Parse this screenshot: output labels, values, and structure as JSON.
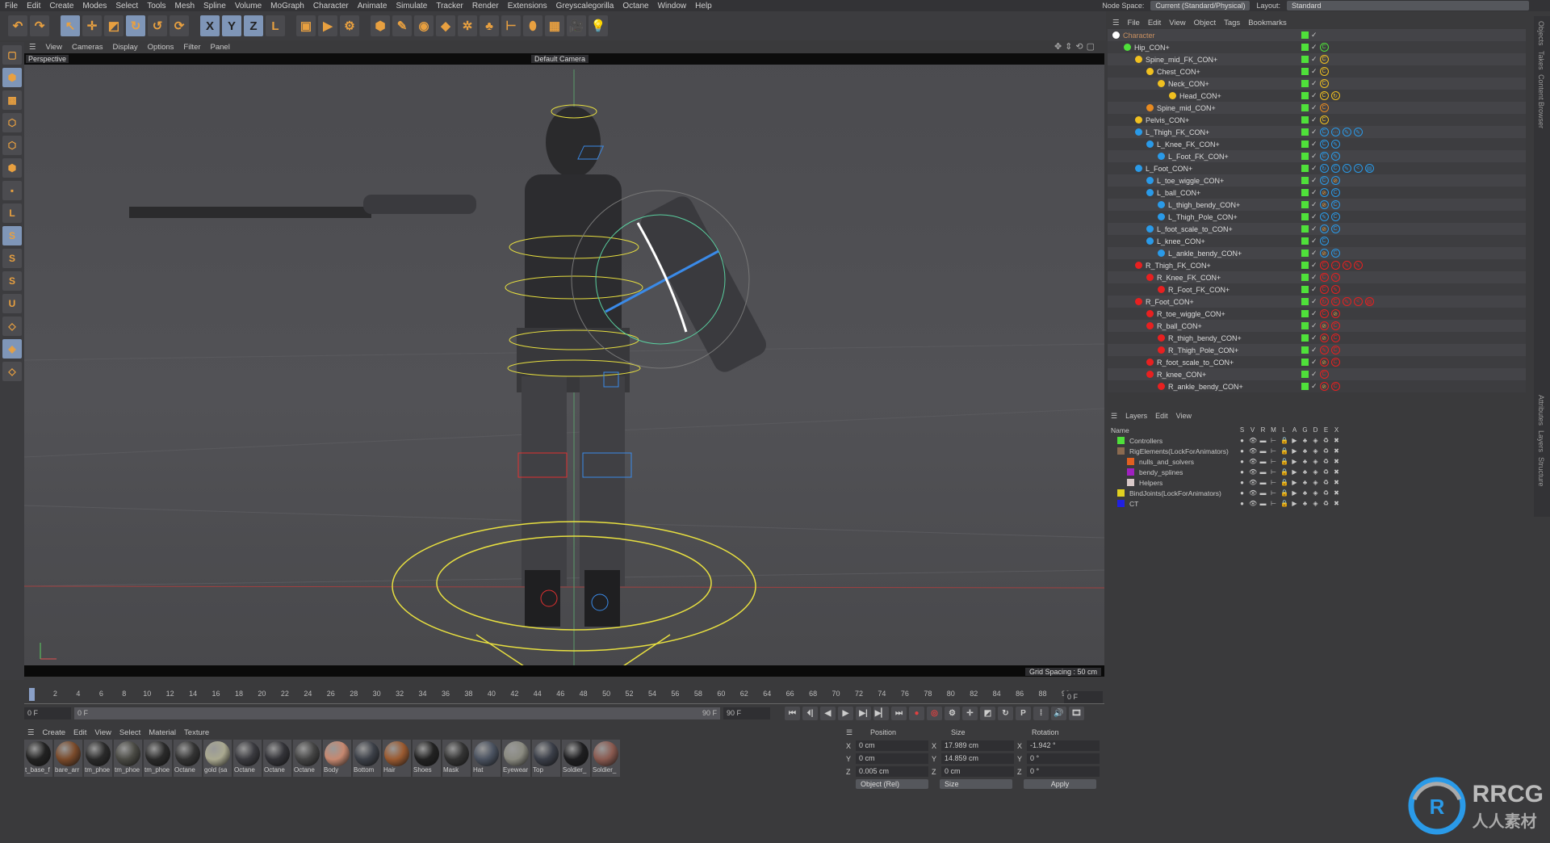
{
  "menu": [
    "File",
    "Edit",
    "Create",
    "Modes",
    "Select",
    "Tools",
    "Mesh",
    "Spline",
    "Volume",
    "MoGraph",
    "Character",
    "Animate",
    "Simulate",
    "Tracker",
    "Render",
    "Extensions",
    "Greyscalegorilla",
    "Octane",
    "Window",
    "Help"
  ],
  "header": {
    "node_space_label": "Node Space:",
    "node_space_value": "Current (Standard/Physical)",
    "layout_label": "Layout:",
    "layout_value": "Standard"
  },
  "toolbar": [
    {
      "icon": "undo-icon",
      "g": "↶"
    },
    {
      "icon": "redo-icon",
      "g": "↷"
    },
    {
      "icon": "select-icon",
      "g": "↖",
      "hl": true
    },
    {
      "icon": "move-icon",
      "g": "✛"
    },
    {
      "icon": "scale-icon",
      "g": "◩"
    },
    {
      "icon": "rotate-icon",
      "g": "↻",
      "hl": true
    },
    {
      "icon": "psr-icon",
      "g": "↺"
    },
    {
      "icon": "recent-tool-icon",
      "g": "⟳"
    },
    {
      "icon": "x-axis-icon",
      "g": "X",
      "hl": true
    },
    {
      "icon": "y-axis-icon",
      "g": "Y",
      "hl": true
    },
    {
      "icon": "z-axis-icon",
      "g": "Z",
      "hl": true
    },
    {
      "icon": "coordinate-system-icon",
      "g": "L"
    },
    {
      "icon": "render-region-icon",
      "g": "▣"
    },
    {
      "icon": "render-view-icon",
      "g": "▶"
    },
    {
      "icon": "render-settings-icon",
      "g": "⚙"
    },
    {
      "icon": "cube-icon",
      "g": "⬢"
    },
    {
      "icon": "pen-icon",
      "g": "✎"
    },
    {
      "icon": "subdivision-icon",
      "g": "◉"
    },
    {
      "icon": "extrude-icon",
      "g": "◆"
    },
    {
      "icon": "cloner-icon",
      "g": "✲"
    },
    {
      "icon": "mograph-icon",
      "g": "♣"
    },
    {
      "icon": "deformer-icon",
      "g": "⊢"
    },
    {
      "icon": "field-icon",
      "g": "⬮"
    },
    {
      "icon": "floor-icon",
      "g": "▦"
    },
    {
      "icon": "camera-icon",
      "g": "🎥"
    },
    {
      "icon": "light-icon",
      "g": "💡"
    }
  ],
  "left_tools": [
    {
      "icon": "make-editable-icon",
      "g": "▢"
    },
    {
      "icon": "model-mode-icon",
      "g": "⬢",
      "hl": true
    },
    {
      "icon": "texture-mode-icon",
      "g": "▩"
    },
    {
      "icon": "points-mode-icon",
      "g": "⬡"
    },
    {
      "icon": "edges-mode-icon",
      "g": "⬡"
    },
    {
      "icon": "polygons-mode-icon",
      "g": "⬢"
    },
    {
      "icon": "uv-mode-icon",
      "g": "▪"
    },
    {
      "icon": "axis-mode-icon",
      "g": "L"
    },
    {
      "icon": "snap-icon",
      "g": "S",
      "hl": true
    },
    {
      "icon": "snap-settings-icon",
      "g": "S"
    },
    {
      "icon": "snap-alt-icon",
      "g": "S"
    },
    {
      "icon": "magnet-icon",
      "g": "U"
    },
    {
      "icon": "workplane-icon",
      "g": "◇"
    },
    {
      "icon": "lock-workplane-icon",
      "g": "◈",
      "hl": true
    },
    {
      "icon": "workplane-rotate-icon",
      "g": "◇"
    }
  ],
  "viewport": {
    "menu": [
      "View",
      "Cameras",
      "Display",
      "Options",
      "Filter",
      "Panel"
    ],
    "name": "Perspective",
    "camera": "Default Camera",
    "grid_spacing": "Grid Spacing : 50 cm"
  },
  "timeline": {
    "start": 0,
    "end": 90,
    "step": 2,
    "current": "0 F",
    "range_start": "0 F",
    "range_label_start": "0 F",
    "range_label_end": "90 F",
    "range_end": "90 F",
    "current_field": "0 F"
  },
  "playback": [
    {
      "icon": "go-start-icon",
      "g": "⏮"
    },
    {
      "icon": "prev-key-icon",
      "g": "⏴|"
    },
    {
      "icon": "prev-frame-icon",
      "g": "◀"
    },
    {
      "icon": "play-icon",
      "g": "▶"
    },
    {
      "icon": "next-frame-icon",
      "g": "▶|"
    },
    {
      "icon": "next-key-icon",
      "g": "▶▏"
    },
    {
      "icon": "go-end-icon",
      "g": "⏭"
    },
    {
      "icon": "record-icon",
      "g": "●"
    },
    {
      "icon": "auto-key-icon",
      "g": "◎"
    },
    {
      "icon": "key-settings-icon",
      "g": "⚙"
    },
    {
      "icon": "key-position-icon",
      "g": "✛"
    },
    {
      "icon": "key-scale-icon",
      "g": "◩"
    },
    {
      "icon": "key-rotation-icon",
      "g": "↻"
    },
    {
      "icon": "key-param-icon",
      "g": "P"
    },
    {
      "icon": "key-pla-icon",
      "g": "⁞"
    },
    {
      "icon": "sound-icon",
      "g": "🔊"
    },
    {
      "icon": "film-icon",
      "g": "🎞"
    }
  ],
  "materials": {
    "menu": [
      "Create",
      "Edit",
      "View",
      "Select",
      "Material",
      "Texture"
    ],
    "items": [
      {
        "n": "t_base_f",
        "c": "#222"
      },
      {
        "n": "bare_arr",
        "c": "#7a4a2a"
      },
      {
        "n": "tm_phoe",
        "c": "#2a2a2a"
      },
      {
        "n": "tm_phoe",
        "c": "#4a4a44"
      },
      {
        "n": "tm_phoe",
        "c": "#2a2a2a"
      },
      {
        "n": "Octane",
        "c": "#333"
      },
      {
        "n": "gold (sa",
        "c": "#aaa990"
      },
      {
        "n": "Octane",
        "c": "#3a3a3f"
      },
      {
        "n": "Octane",
        "c": "#333338"
      },
      {
        "n": "Octane",
        "c": "#444"
      },
      {
        "n": "Body",
        "c": "#c68870"
      },
      {
        "n": "Bottom",
        "c": "#3c4048"
      },
      {
        "n": "Hair",
        "c": "#9a5a30"
      },
      {
        "n": "Shoes",
        "c": "#222"
      },
      {
        "n": "Mask",
        "c": "#333"
      },
      {
        "n": "Hat",
        "c": "#4a5260"
      },
      {
        "n": "Eyewear",
        "c": "#8a8a80"
      },
      {
        "n": "Top",
        "c": "#3a3e48"
      },
      {
        "n": "Soldier_",
        "c": "#1e1e20"
      },
      {
        "n": "Soldier_",
        "c": "#8a5a50"
      }
    ]
  },
  "coordinates": {
    "headers": [
      "Position",
      "Size",
      "Rotation"
    ],
    "rows": [
      {
        "axis": "X",
        "pos": "0 cm",
        "size": "17.989 cm",
        "rot": "-1.942 °"
      },
      {
        "axis": "Y",
        "pos": "0 cm",
        "size": "14.859 cm",
        "rot": "0 °"
      },
      {
        "axis": "Z",
        "pos": "0.005 cm",
        "size": "0 cm",
        "rot": "0 °"
      }
    ],
    "mode": "Object (Rel)",
    "size_mode": "Size",
    "apply": "Apply"
  },
  "objects": {
    "menu": [
      "File",
      "Edit",
      "View",
      "Object",
      "Tags",
      "Bookmarks"
    ],
    "items": [
      {
        "name": "Character",
        "d": 0,
        "c": "#ffffff",
        "tags": []
      },
      {
        "name": "Hip_CON+",
        "d": 1,
        "c": "#4fe03a",
        "tags": [
          "C"
        ]
      },
      {
        "name": "Spine_mid_FK_CON+",
        "d": 2,
        "c": "#f0c020",
        "tags": [
          "C"
        ]
      },
      {
        "name": "Chest_CON+",
        "d": 3,
        "c": "#f0c020",
        "tags": [
          "C"
        ]
      },
      {
        "name": "Neck_CON+",
        "d": 4,
        "c": "#f0c020",
        "tags": [
          "C"
        ]
      },
      {
        "name": "Head_CON+",
        "d": 5,
        "c": "#f0c020",
        "tags": [
          "C",
          "↻"
        ]
      },
      {
        "name": "Spine_mid_CON+",
        "d": 3,
        "c": "#e88a20",
        "tags": [
          "C"
        ]
      },
      {
        "name": "Pelvis_CON+",
        "d": 2,
        "c": "#f0c020",
        "tags": [
          "C"
        ]
      },
      {
        "name": "L_Thigh_FK_CON+",
        "d": 2,
        "c": "#2a9ae8",
        "tags": [
          "C",
          "⋯",
          "✎",
          "✎"
        ]
      },
      {
        "name": "L_Knee_FK_CON+",
        "d": 3,
        "c": "#2a9ae8",
        "tags": [
          "C",
          "✎"
        ]
      },
      {
        "name": "L_Foot_FK_CON+",
        "d": 4,
        "c": "#2a9ae8",
        "tags": [
          "C",
          "✎"
        ]
      },
      {
        "name": "L_Foot_CON+",
        "d": 2,
        "c": "#2a9ae8",
        "tags": [
          "↻",
          "C",
          "✎",
          "<",
          "▤"
        ]
      },
      {
        "name": "L_toe_wiggle_CON+",
        "d": 3,
        "c": "#2a9ae8",
        "tags": [
          "C",
          "⊘"
        ]
      },
      {
        "name": "L_ball_CON+",
        "d": 3,
        "c": "#2a9ae8",
        "tags": [
          "⊘",
          "C"
        ]
      },
      {
        "name": "L_thigh_bendy_CON+",
        "d": 4,
        "c": "#2a9ae8",
        "tags": [
          "⊘",
          "C"
        ]
      },
      {
        "name": "L_Thigh_Pole_CON+",
        "d": 4,
        "c": "#2a9ae8",
        "tags": [
          "✎",
          "C"
        ]
      },
      {
        "name": "L_foot_scale_to_CON+",
        "d": 3,
        "c": "#2a9ae8",
        "tags": [
          "⊘",
          "C"
        ]
      },
      {
        "name": "L_knee_CON+",
        "d": 3,
        "c": "#2a9ae8",
        "tags": [
          "C"
        ]
      },
      {
        "name": "L_ankle_bendy_CON+",
        "d": 4,
        "c": "#2a9ae8",
        "tags": [
          "⊘",
          "C"
        ]
      },
      {
        "name": "R_Thigh_FK_CON+",
        "d": 2,
        "c": "#e82020",
        "tags": [
          "C",
          "⋯",
          "✎",
          "✎"
        ]
      },
      {
        "name": "R_Knee_FK_CON+",
        "d": 3,
        "c": "#e82020",
        "tags": [
          "C",
          "✎"
        ]
      },
      {
        "name": "R_Foot_FK_CON+",
        "d": 4,
        "c": "#e82020",
        "tags": [
          "C",
          "✎"
        ]
      },
      {
        "name": "R_Foot_CON+",
        "d": 2,
        "c": "#e82020",
        "tags": [
          "↻",
          "C",
          "✎",
          "<",
          "▤"
        ]
      },
      {
        "name": "R_toe_wiggle_CON+",
        "d": 3,
        "c": "#e82020",
        "tags": [
          "C",
          "⊘"
        ]
      },
      {
        "name": "R_ball_CON+",
        "d": 3,
        "c": "#e82020",
        "tags": [
          "⊘",
          "C"
        ]
      },
      {
        "name": "R_thigh_bendy_CON+",
        "d": 4,
        "c": "#e82020",
        "tags": [
          "⊘",
          "C"
        ]
      },
      {
        "name": "R_Thigh_Pole_CON+",
        "d": 4,
        "c": "#e82020",
        "tags": [
          "✎",
          "C"
        ]
      },
      {
        "name": "R_foot_scale_to_CON+",
        "d": 3,
        "c": "#e82020",
        "tags": [
          "⊘",
          "C"
        ]
      },
      {
        "name": "R_knee_CON+",
        "d": 3,
        "c": "#e82020",
        "tags": [
          "C"
        ]
      },
      {
        "name": "R_ankle_bendy_CON+",
        "d": 4,
        "c": "#e82020",
        "tags": [
          "⊘",
          "C"
        ]
      }
    ]
  },
  "layers": {
    "menu": [
      "Layers",
      "Edit",
      "View"
    ],
    "name_header": "Name",
    "columns": [
      "S",
      "V",
      "R",
      "M",
      "L",
      "A",
      "G",
      "D",
      "E",
      "X"
    ],
    "items": [
      {
        "name": "Controllers",
        "d": 0,
        "c": "#4fe03a"
      },
      {
        "name": "RigElements(LockForAnimators)",
        "d": 0,
        "c": "#8a6a50"
      },
      {
        "name": "nulls_and_solvers",
        "d": 1,
        "c": "#e06020"
      },
      {
        "name": "bendy_splines",
        "d": 1,
        "c": "#a020c0"
      },
      {
        "name": "Helpers",
        "d": 1,
        "c": "#d8c8c8"
      },
      {
        "name": "BindJoints(LockForAnimators)",
        "d": 0,
        "c": "#e0d020"
      },
      {
        "name": "CT",
        "d": 0,
        "c": "#2020e0"
      }
    ]
  },
  "right_tabs_top": [
    "Objects",
    "Takes",
    "Content Browser"
  ],
  "right_tabs_bottom": [
    "Attributes",
    "Layers",
    "Structure"
  ],
  "watermark": {
    "latin": "RRCG",
    "chinese": "人人素材"
  }
}
